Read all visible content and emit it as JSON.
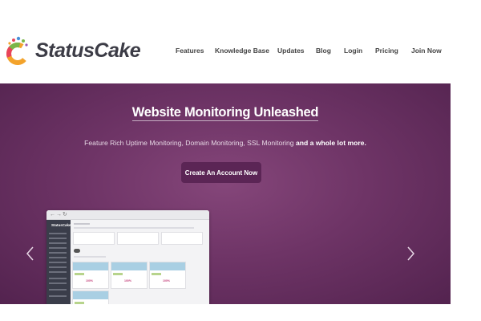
{
  "brand": {
    "name": "StatusCake"
  },
  "nav": {
    "items": [
      {
        "label": "Features"
      },
      {
        "label": "Knowledge Base"
      },
      {
        "label": "Updates"
      },
      {
        "label": "Blog"
      },
      {
        "label": "Login"
      },
      {
        "label": "Pricing"
      },
      {
        "label": "Join Now"
      }
    ]
  },
  "hero": {
    "title": "Website Monitoring Unleashed",
    "subtitle_plain": "Feature Rich Uptime Monitoring, Domain Monitoring, SSL Monitoring",
    "subtitle_bold": "and a whole lot more.",
    "cta_label": "Create An Account Now",
    "prev_icon": "chevron-left-icon",
    "next_icon": "chevron-right-icon"
  },
  "mock": {
    "brand": "StatusCake"
  },
  "colors": {
    "hero_center": "#85467a",
    "hero_edge": "#53234f",
    "cta_bg": "#5b2555",
    "nav_text": "#444444"
  }
}
